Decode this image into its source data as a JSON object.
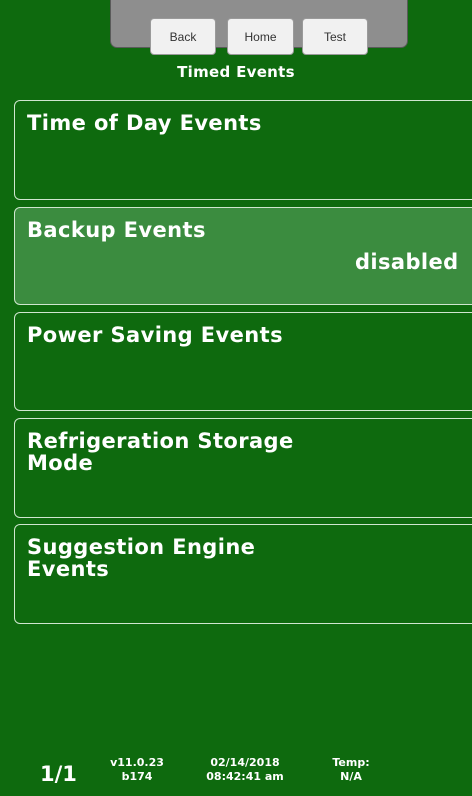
{
  "header": {
    "back_label": "Back",
    "home_label": "Home",
    "test_label": "Test",
    "title": "Timed Events"
  },
  "rows": [
    {
      "label": "Time of Day Events",
      "status": ""
    },
    {
      "label": "Backup Events",
      "status": "disabled"
    },
    {
      "label": "Power Saving Events",
      "status": ""
    },
    {
      "label": "Refrigeration Storage\nMode",
      "status": ""
    },
    {
      "label": "Suggestion Engine\nEvents",
      "status": ""
    }
  ],
  "footer": {
    "page": "1/1",
    "version": "v11.0.23",
    "build": "b174",
    "date": "02/14/2018",
    "time": "08:42:41 am",
    "temp_label": "Temp:",
    "temp_value": "N/A"
  },
  "colors": {
    "background": "#0e6a0e",
    "row_active": "#3b8c3f",
    "topbar": "#8e8e8e"
  }
}
